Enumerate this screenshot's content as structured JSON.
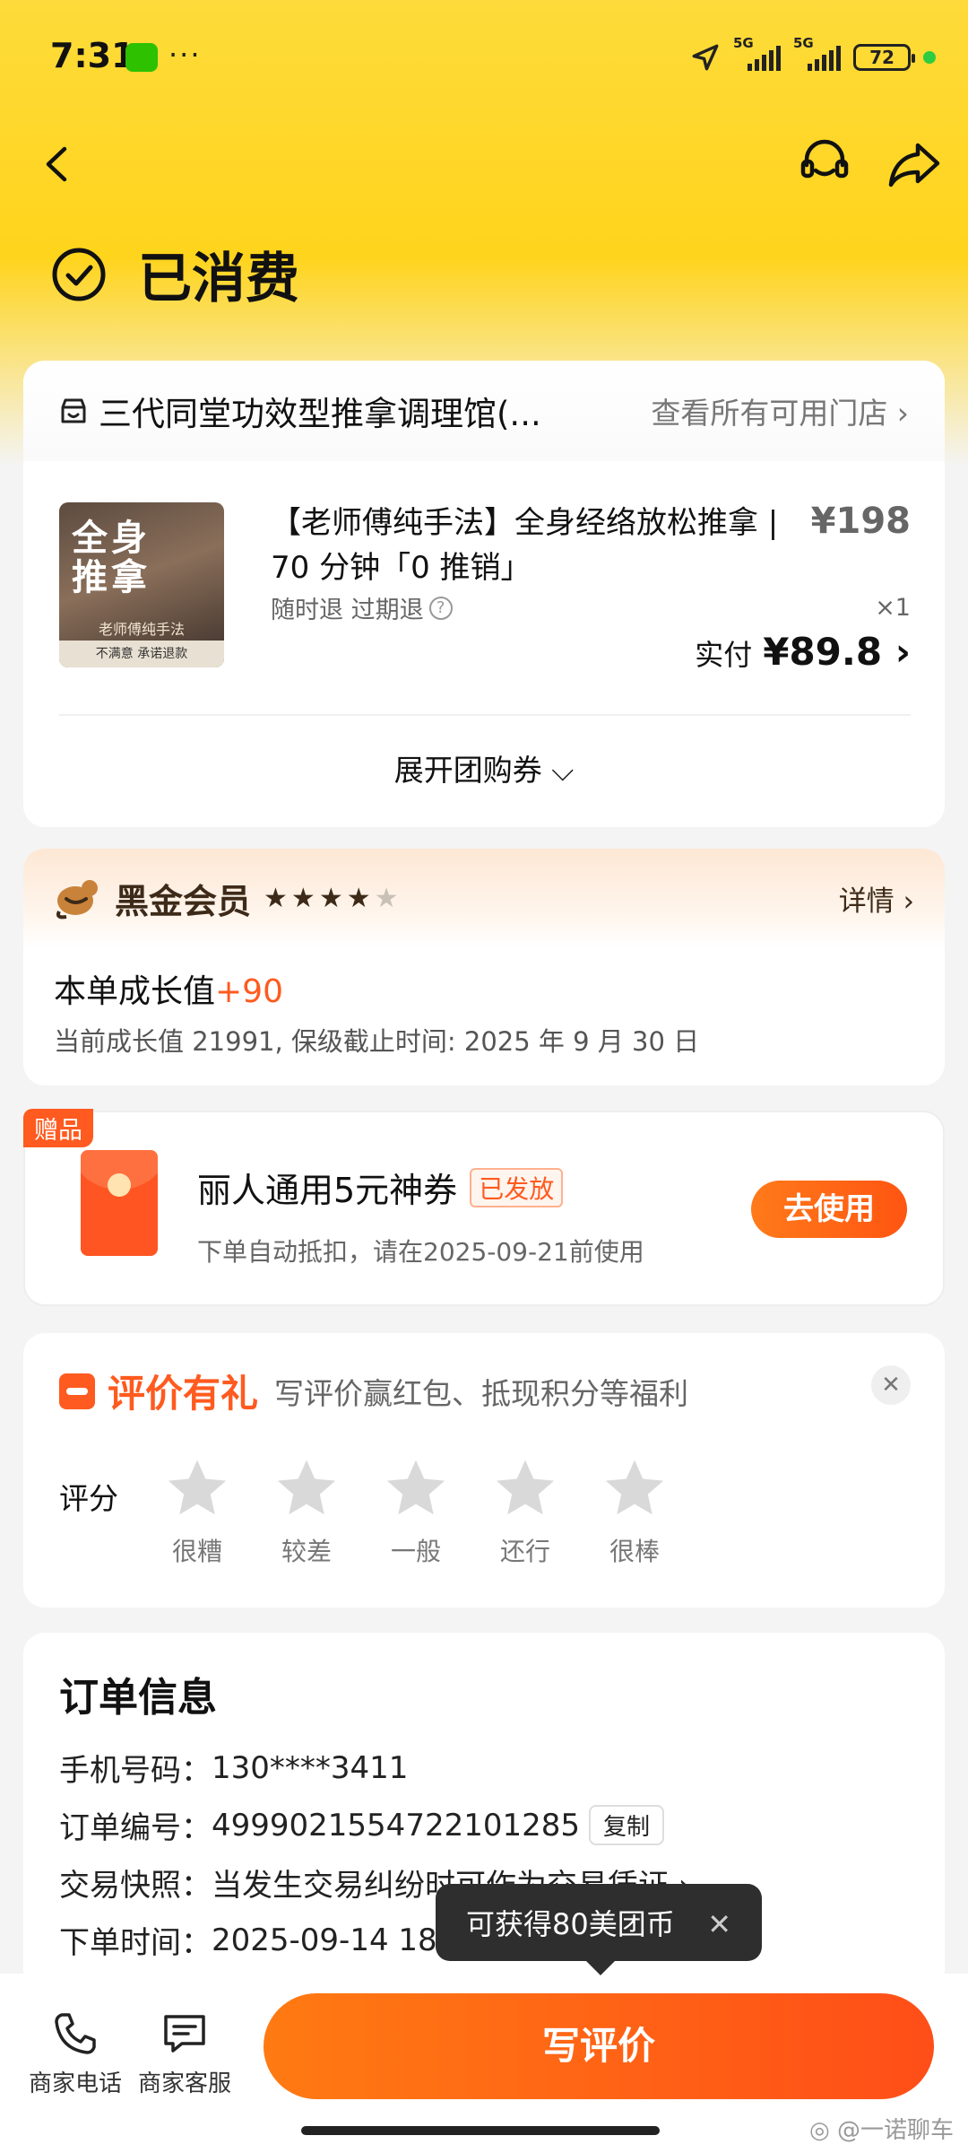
{
  "status_bar": {
    "time": "7:31",
    "dots": "···",
    "net1": "5G",
    "net2": "5G",
    "battery": "72"
  },
  "header": {
    "status_title": "已消费"
  },
  "shop": {
    "name": "三代同堂功效型推拿调理馆(...",
    "stores_link": "查看所有可用门店 ›"
  },
  "product": {
    "thumb_big": "全身\n推拿",
    "thumb_sub": "老师傅纯手法",
    "thumb_bar": "不满意 承诺退款",
    "title": "【老师傅纯手法】全身经络放松推拿 | 70 分钟「0 推销」",
    "tags": "随时退 过期退",
    "price": "¥198",
    "qty": "×1",
    "paid_label": "实付",
    "paid_value": "¥89.8 ›"
  },
  "expand": {
    "label": "展开团购券 ⌵"
  },
  "vip": {
    "title": "黑金会员",
    "stars_on": 4,
    "stars_total": 5,
    "detail": "详情 ›",
    "growth_label": "本单成长值",
    "growth_plus": "+90",
    "note": "当前成长值 21991, 保级截止时间: 2025 年 9 月 30 日",
    "colors": {
      "accent": "#3d2a18"
    }
  },
  "gift": {
    "badge": "赠品",
    "title": "丽人通用5元神券",
    "tag": "已发放",
    "desc": "下单自动抵扣，请在2025-09-21前使用",
    "button": "去使用"
  },
  "review": {
    "title": "评价有礼",
    "subtitle": "写评价赢红包、抵现积分等福利",
    "close": "✕",
    "rating_label": "评分",
    "stars": [
      "很糟",
      "较差",
      "一般",
      "还行",
      "很棒"
    ]
  },
  "order": {
    "title": "订单信息",
    "rows": [
      {
        "k": "手机号码：",
        "v": "130****3411"
      },
      {
        "k": "订单编号：",
        "v": "4999021554722101285"
      },
      {
        "k": "交易快照：",
        "v": "当发生交易纠纷时可作为交易凭证 ›"
      },
      {
        "k": "下单时间：",
        "v": "2025-09-14 18:23:35"
      }
    ],
    "copy": "复制"
  },
  "tooltip": {
    "text": "可获得80美团币",
    "close": "✕"
  },
  "bottom": {
    "phone_label": "商家电话",
    "service_label": "商家客服",
    "write_review": "写评价"
  },
  "watermark": "◎ @一诺聊车",
  "colors": {
    "brand_yellow": "#ffd41c",
    "orange": "#ff5a1f"
  }
}
